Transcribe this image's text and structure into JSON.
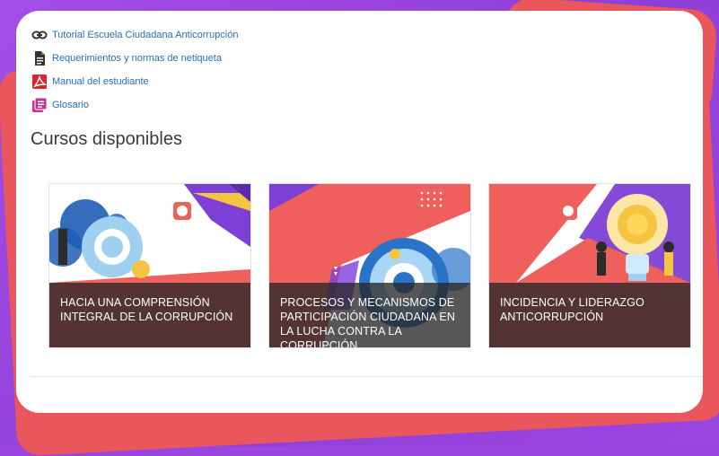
{
  "resources": [
    {
      "icon": "link-icon",
      "label": "Tutorial Escuela Ciudadana Anticorrupción",
      "color": "#333333"
    },
    {
      "icon": "document-icon",
      "label": "Requerimientos y normas de netiqueta",
      "color": "#333333"
    },
    {
      "icon": "pdf-icon",
      "label": "Manual del estudiante",
      "color": "#d8262b"
    },
    {
      "icon": "glossary-icon",
      "label": "Glosario",
      "color": "#c2338f"
    }
  ],
  "section": {
    "title": "Cursos disponibles"
  },
  "courses": [
    {
      "title": "HACIA UNA COMPRENSIÓN INTEGRAL DE LA CORRUPCIÓN"
    },
    {
      "title": "PROCESOS Y MECANISMOS DE PARTICIPACIÓN CIUDADANA EN LA LUCHA CONTRA LA CORRUPCIÓN"
    },
    {
      "title": "INCIDENCIA Y LIDERAZGO ANTICORRUPCIÓN"
    }
  ],
  "colors": {
    "accent": "#e9575c",
    "purple": "#9b45e0",
    "link": "#2a6fb8",
    "card_red": "#ef5f5b",
    "card_purple": "#7e3fd6"
  }
}
